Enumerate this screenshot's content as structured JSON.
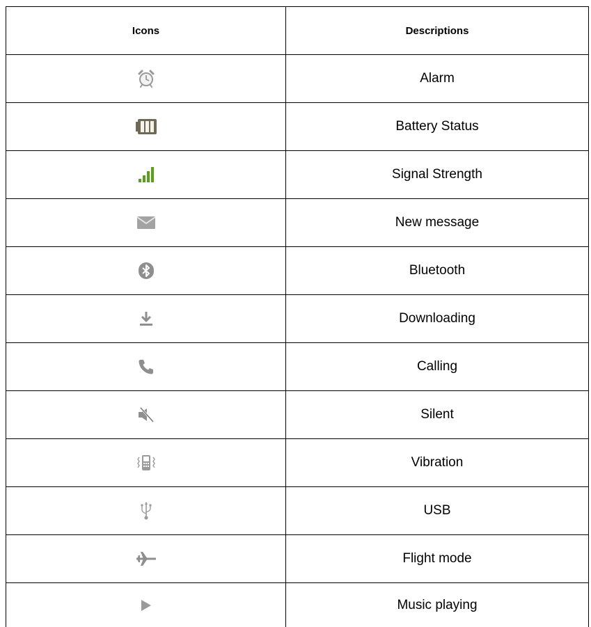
{
  "table": {
    "headers": {
      "icons": "Icons",
      "descriptions": "Descriptions"
    },
    "rows": [
      {
        "icon": "alarm-clock-icon",
        "description": "Alarm"
      },
      {
        "icon": "battery-icon",
        "description": "Battery Status"
      },
      {
        "icon": "signal-strength-icon",
        "description": "Signal Strength"
      },
      {
        "icon": "envelope-icon",
        "description": "New message"
      },
      {
        "icon": "bluetooth-icon",
        "description": "Bluetooth"
      },
      {
        "icon": "download-icon",
        "description": "Downloading"
      },
      {
        "icon": "phone-handset-icon",
        "description": "Calling"
      },
      {
        "icon": "speaker-muted-icon",
        "description": "Silent"
      },
      {
        "icon": "vibrating-phone-icon",
        "description": "Vibration"
      },
      {
        "icon": "usb-icon",
        "description": "USB"
      },
      {
        "icon": "airplane-icon",
        "description": "Flight mode"
      },
      {
        "icon": "play-icon",
        "description": "Music playing"
      }
    ]
  },
  "colors": {
    "icon_gray": "#9a9a9a",
    "battery_olive": "#6f6a55",
    "signal_green": "#5aa017",
    "border": "#000000"
  }
}
